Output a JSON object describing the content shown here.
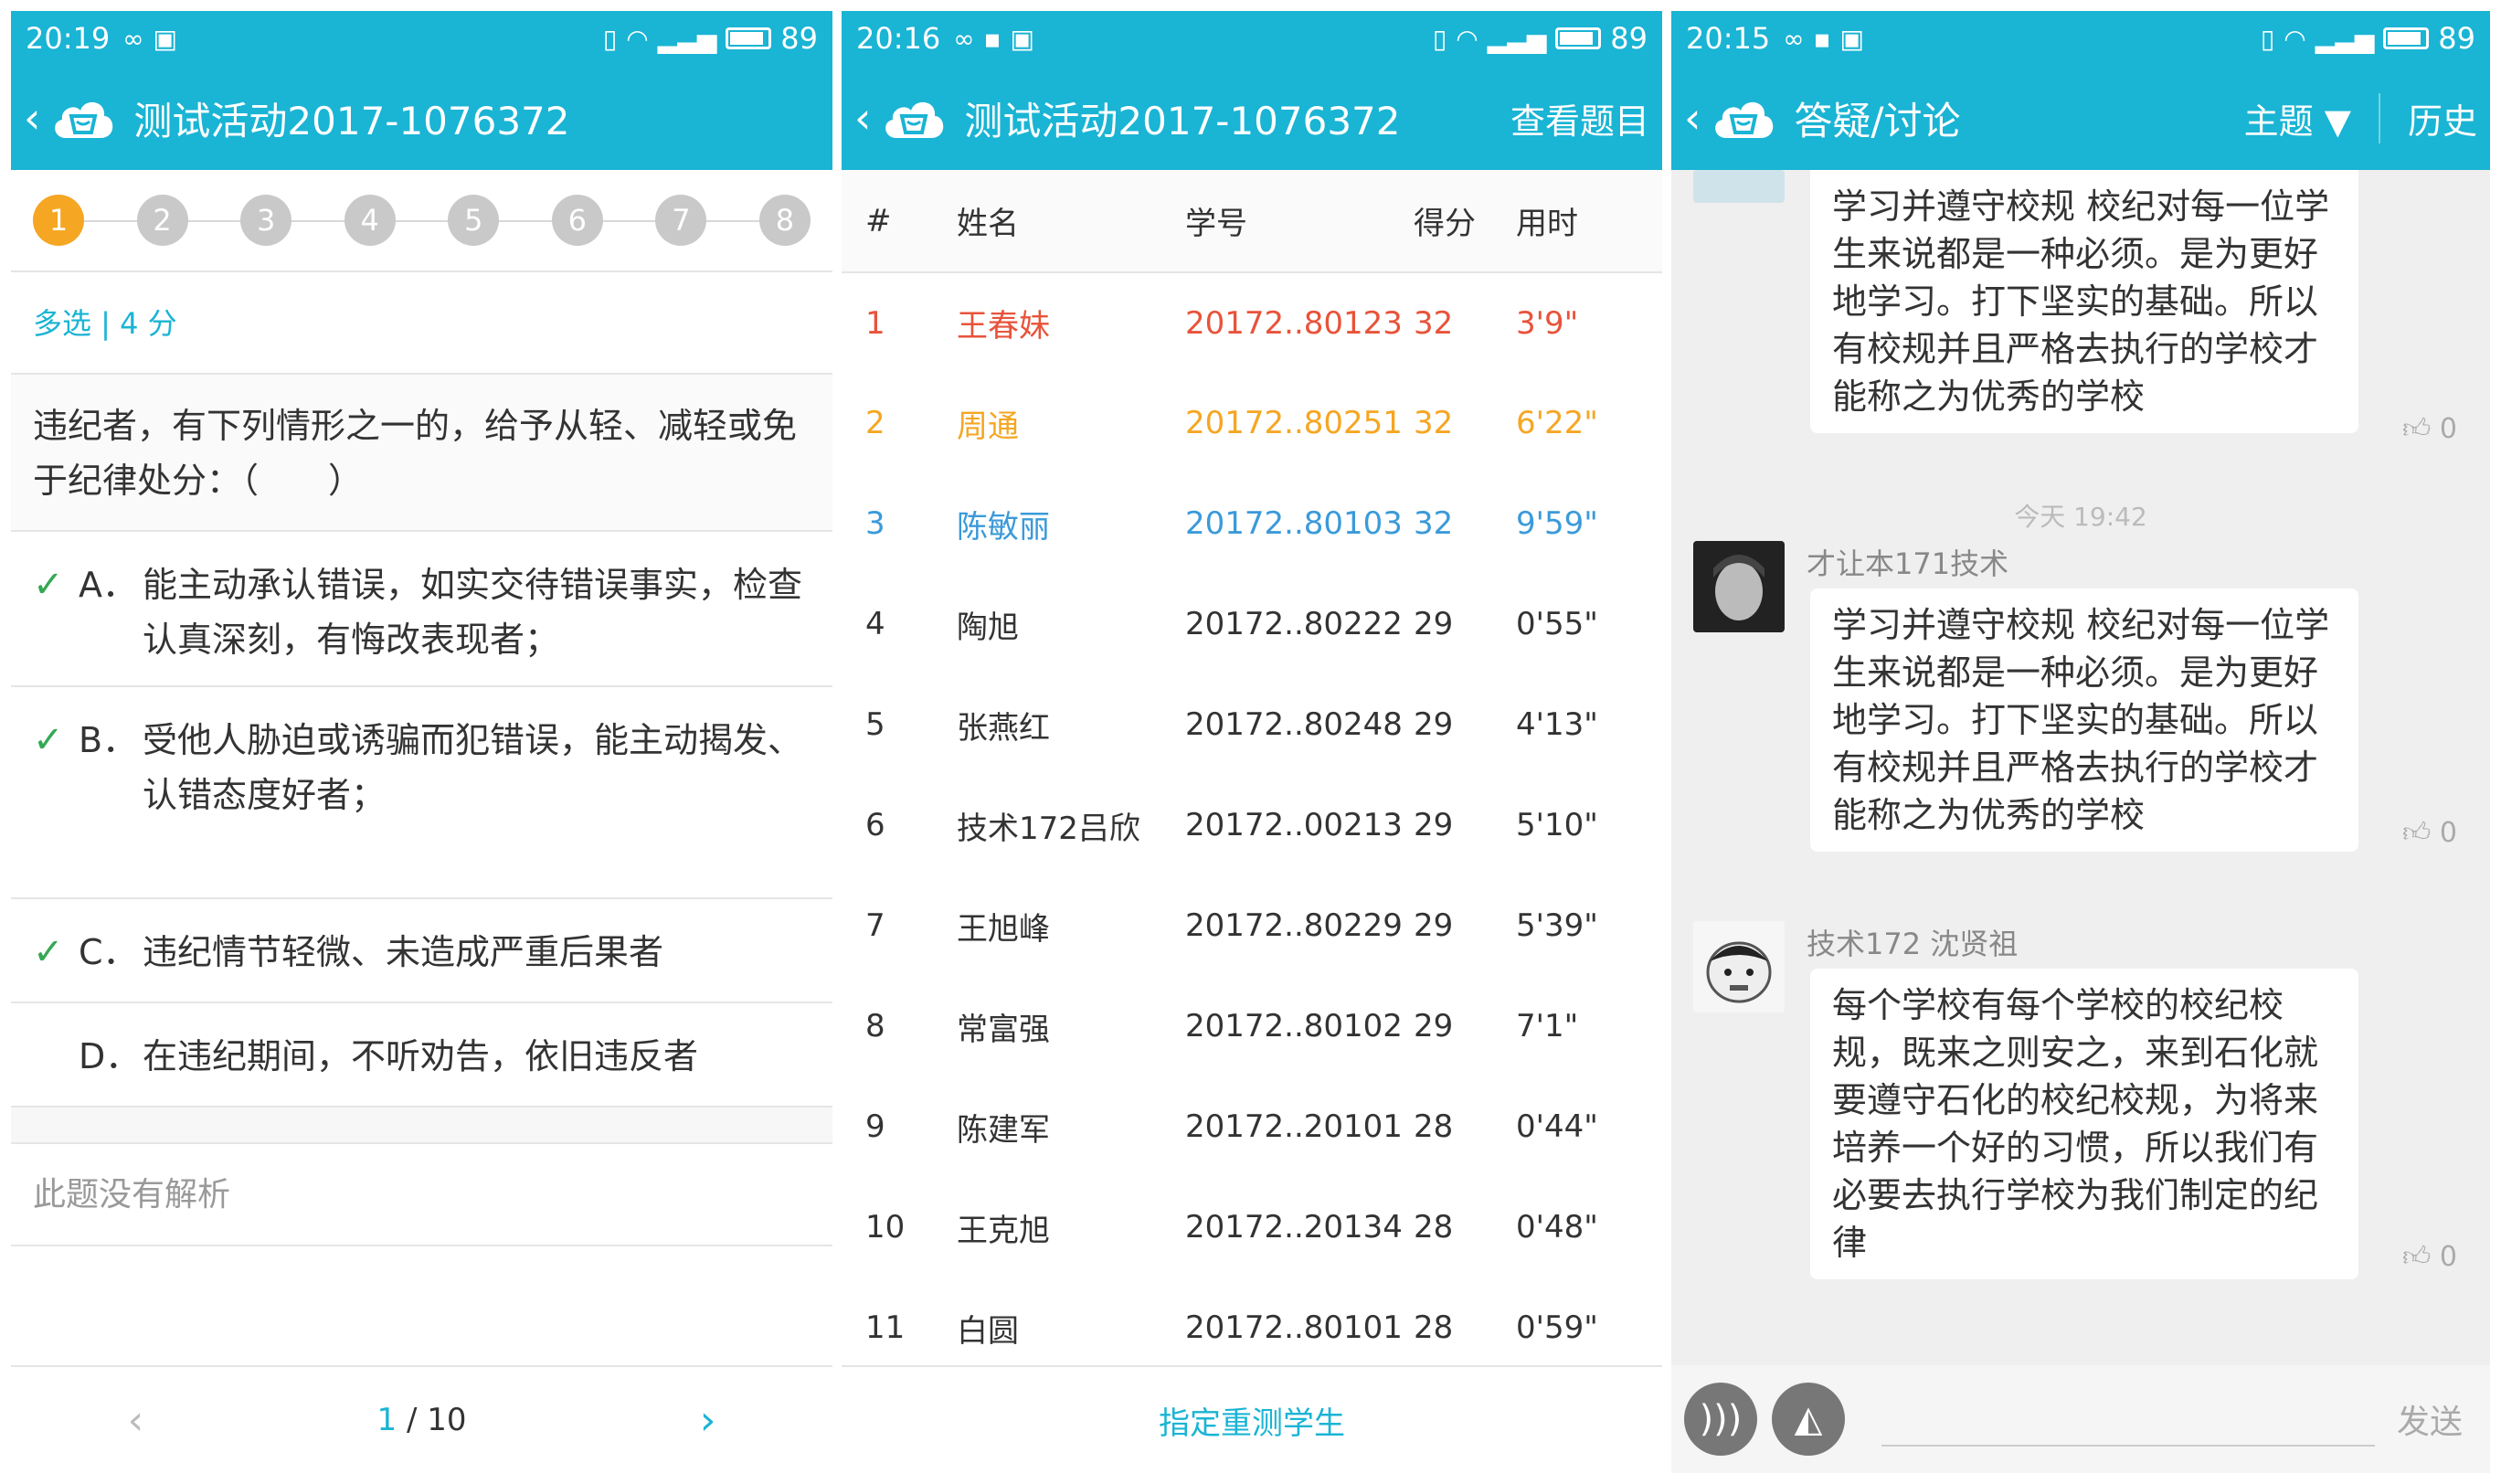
{
  "panel1": {
    "status": {
      "time": "20:19",
      "battery": "89"
    },
    "title": "测试活动2017-1076372",
    "steps": [
      "1",
      "2",
      "3",
      "4",
      "5",
      "6",
      "7",
      "8"
    ],
    "qtype": "多选 | 4 分",
    "question": "违纪者，有下列情形之一的，给予从轻、减轻或免于纪律处分：（　　）",
    "options": [
      {
        "letter": "A．",
        "text": "能主动承认错误，如实交待错误事实，检查认真深刻，有悔改表现者；",
        "checked": true
      },
      {
        "letter": "B．",
        "text": "受他人胁迫或诱骗而犯错误，能主动揭发、认错态度好者；",
        "checked": true
      },
      {
        "letter": "C．",
        "text": "违纪情节轻微、未造成严重后果者",
        "checked": true
      },
      {
        "letter": "D．",
        "text": "在违纪期间，不听劝告，依旧违反者",
        "checked": false
      }
    ],
    "analysis": "此题没有解析",
    "pager": {
      "current": "1",
      "total": " / 10"
    }
  },
  "panel2": {
    "status": {
      "time": "20:16",
      "battery": "89"
    },
    "title": "测试活动2017-1076372",
    "action": "查看题目",
    "headers": [
      "#",
      "姓名",
      "学号",
      "得分",
      "用时"
    ],
    "rows": [
      {
        "no": "1",
        "name": "王春妹",
        "id": "20172..80123",
        "score": "32",
        "time": "3'9\"",
        "color": "#e8533a"
      },
      {
        "no": "2",
        "name": "周通",
        "id": "20172..80251",
        "score": "32",
        "time": "6'22\"",
        "color": "#f5a623"
      },
      {
        "no": "3",
        "name": "陈敏丽",
        "id": "20172..80103",
        "score": "32",
        "time": "9'59\"",
        "color": "#3b9ad9"
      },
      {
        "no": "4",
        "name": "陶旭",
        "id": "20172..80222",
        "score": "29",
        "time": "0'55\"",
        "color": "#333333"
      },
      {
        "no": "5",
        "name": "张燕红",
        "id": "20172..80248",
        "score": "29",
        "time": "4'13\"",
        "color": "#333333"
      },
      {
        "no": "6",
        "name": "技术172吕欣",
        "id": "20172..00213",
        "score": "29",
        "time": "5'10\"",
        "color": "#333333"
      },
      {
        "no": "7",
        "name": "王旭峰",
        "id": "20172..80229",
        "score": "29",
        "time": "5'39\"",
        "color": "#333333"
      },
      {
        "no": "8",
        "name": "常富强",
        "id": "20172..80102",
        "score": "29",
        "time": "7'1\"",
        "color": "#333333"
      },
      {
        "no": "9",
        "name": "陈建军",
        "id": "20172..20101",
        "score": "28",
        "time": "0'44\"",
        "color": "#333333"
      },
      {
        "no": "10",
        "name": "王克旭",
        "id": "20172..20134",
        "score": "28",
        "time": "0'48\"",
        "color": "#333333"
      },
      {
        "no": "11",
        "name": "白圆",
        "id": "20172..80101",
        "score": "28",
        "time": "0'59\"",
        "color": "#333333"
      }
    ],
    "footer": "指定重测学生"
  },
  "panel3": {
    "status": {
      "time": "20:15",
      "battery": "89"
    },
    "title": "答疑/讨论",
    "topic": "主题 ▼",
    "history": "历史",
    "messages": [
      {
        "user": "",
        "text": "学习并遵守校规 校纪对每一位学生来说都是一种必须。是为更好地学习。打下坚实的基础。所以有校规并且严格去执行的学校才能称之为优秀的学校",
        "likes": "0"
      },
      {
        "user": "才让本171技术",
        "text": "学习并遵守校规 校纪对每一位学生来说都是一种必须。是为更好地学习。打下坚实的基础。所以有校规并且严格去执行的学校才能称之为优秀的学校",
        "likes": "0"
      },
      {
        "user": "技术172 沈贤祖",
        "text": "每个学校有每个学校的校纪校规，既来之则安之，来到石化就要遵守石化的校纪校规，为将来培养一个好的习惯，所以我们有必要去执行学校为我们制定的纪律",
        "likes": "0"
      }
    ],
    "timestamp": "今天 19:42",
    "send": "发送"
  },
  "colors": {
    "accent": "#1ab4d4",
    "active_step": "#f5a623",
    "check": "#34a853"
  }
}
